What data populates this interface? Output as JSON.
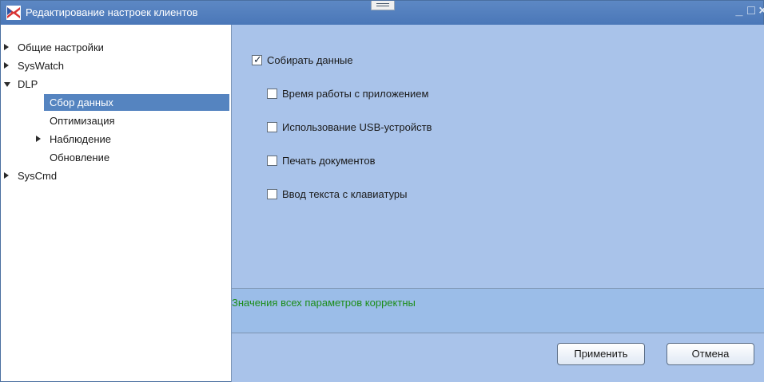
{
  "window": {
    "title": "Редактирование настроек клиентов",
    "controls": {
      "minimize": "_",
      "maximize": "□",
      "close": "×"
    }
  },
  "tree": [
    {
      "label": "Общие настройки",
      "arrow": "right",
      "level": 0
    },
    {
      "label": "SysWatch",
      "arrow": "right",
      "level": 0
    },
    {
      "label": "DLP",
      "arrow": "down",
      "level": 0
    },
    {
      "label": "Сбор данных",
      "arrow": "none",
      "level": 1,
      "selected": true
    },
    {
      "label": "Оптимизация",
      "arrow": "none",
      "level": 1
    },
    {
      "label": "Наблюдение",
      "arrow": "right",
      "level": 1
    },
    {
      "label": "Обновление",
      "arrow": "none",
      "level": 1
    },
    {
      "label": "SysCmd",
      "arrow": "right",
      "level": 0
    }
  ],
  "settings": {
    "collect_data": {
      "label": "Собирать данные",
      "checked": true
    },
    "options": [
      {
        "label": "Время работы с приложением",
        "checked": false
      },
      {
        "label": "Использование USB-устройств",
        "checked": false
      },
      {
        "label": "Печать документов",
        "checked": false
      },
      {
        "label": "Ввод текста с клавиатуры",
        "checked": false
      }
    ]
  },
  "status": {
    "message": "Значения всех параметров корректны",
    "color": "#1c8d1a"
  },
  "buttons": {
    "apply": "Применить",
    "cancel": "Отмена"
  },
  "colors": {
    "titlebar": "#4a77b8",
    "panel": "#a9c3ea",
    "selection": "#5584c0"
  }
}
